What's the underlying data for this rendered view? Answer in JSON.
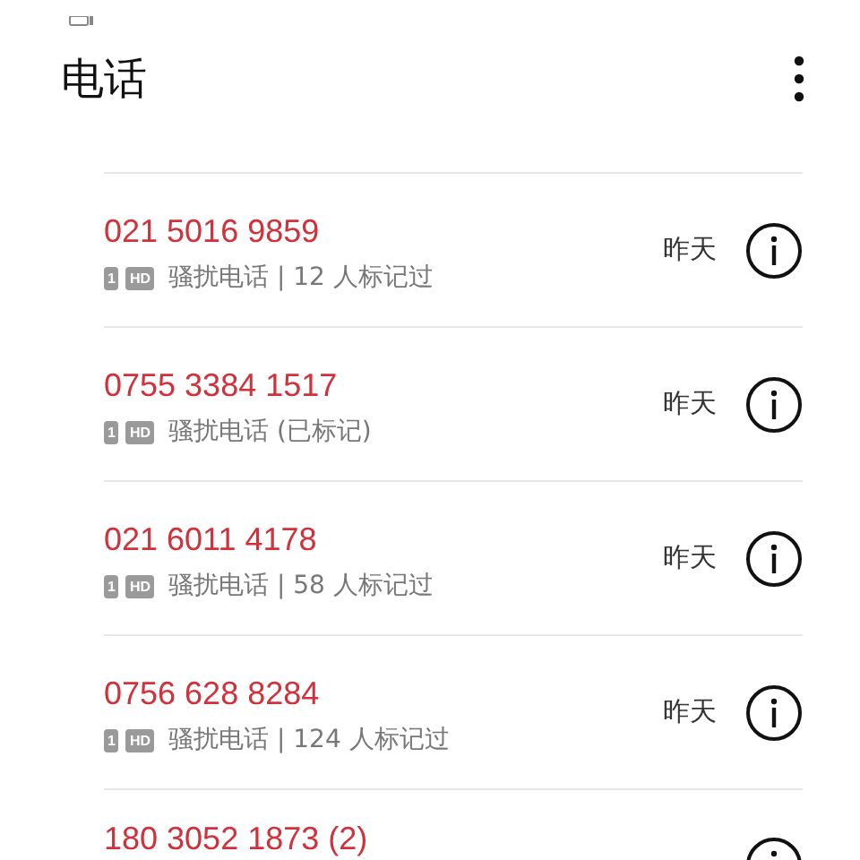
{
  "title": "电话",
  "calls": [
    {
      "number": "021 5016 9859",
      "sim": "1",
      "hd": "HD",
      "label": "骚扰电话 | 12 人标记过",
      "time": "昨天"
    },
    {
      "number": "0755 3384 1517",
      "sim": "1",
      "hd": "HD",
      "label": "骚扰电话 (已标记)",
      "time": "昨天"
    },
    {
      "number": "021 6011 4178",
      "sim": "1",
      "hd": "HD",
      "label": "骚扰电话 | 58 人标记过",
      "time": "昨天"
    },
    {
      "number": "0756 628 8284",
      "sim": "1",
      "hd": "HD",
      "label": "骚扰电话 | 124 人标记过",
      "time": "昨天"
    },
    {
      "number": "180 3052 1873 (2)"
    }
  ]
}
